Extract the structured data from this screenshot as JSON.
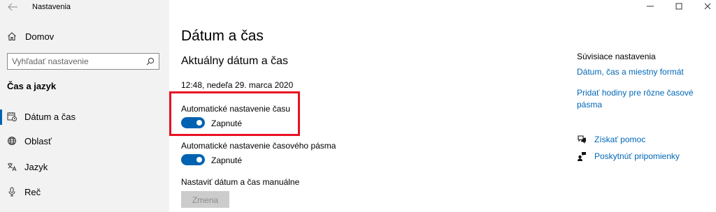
{
  "window": {
    "title": "Nastavenia",
    "controls": [
      "minimize-icon",
      "maximize-icon",
      "close-icon"
    ]
  },
  "sidebar": {
    "home_label": "Domov",
    "search": {
      "placeholder": "Vyhľadať nastavenie"
    },
    "section_title": "Čas a jazyk",
    "items": [
      {
        "label": "Dátum a čas",
        "icon": "calendar-clock-icon",
        "selected": true
      },
      {
        "label": "Oblasť",
        "icon": "globe-icon",
        "selected": false
      },
      {
        "label": "Jazyk",
        "icon": "language-icon",
        "selected": false
      },
      {
        "label": "Reč",
        "icon": "microphone-icon",
        "selected": false
      }
    ]
  },
  "main": {
    "title": "Dátum a čas",
    "subtitle": "Aktuálny dátum a čas",
    "current_datetime": "12:48, nedeľa 29. marca 2020",
    "auto_time": {
      "label": "Automatické nastavenie času",
      "state": "Zapnuté",
      "on": true
    },
    "auto_timezone": {
      "label": "Automatické nastavenie časového pásma",
      "state": "Zapnuté",
      "on": true
    },
    "manual": {
      "label": "Nastaviť dátum a čas manuálne",
      "button": "Zmena",
      "enabled": false
    }
  },
  "related": {
    "title": "Súvisiace nastavenia",
    "links": [
      "Dátum, čas a miestny formát",
      "Pridať hodiny pre rôzne časové pásma"
    ],
    "help": [
      {
        "label": "Získať pomoc",
        "icon": "help-chat-icon"
      },
      {
        "label": "Poskytnúť pripomienky",
        "icon": "feedback-icon"
      }
    ]
  },
  "colors": {
    "accent": "#0063b1",
    "link": "#0067b8",
    "highlight": "#e81123",
    "sidebar_bg": "#f2f2f2"
  }
}
